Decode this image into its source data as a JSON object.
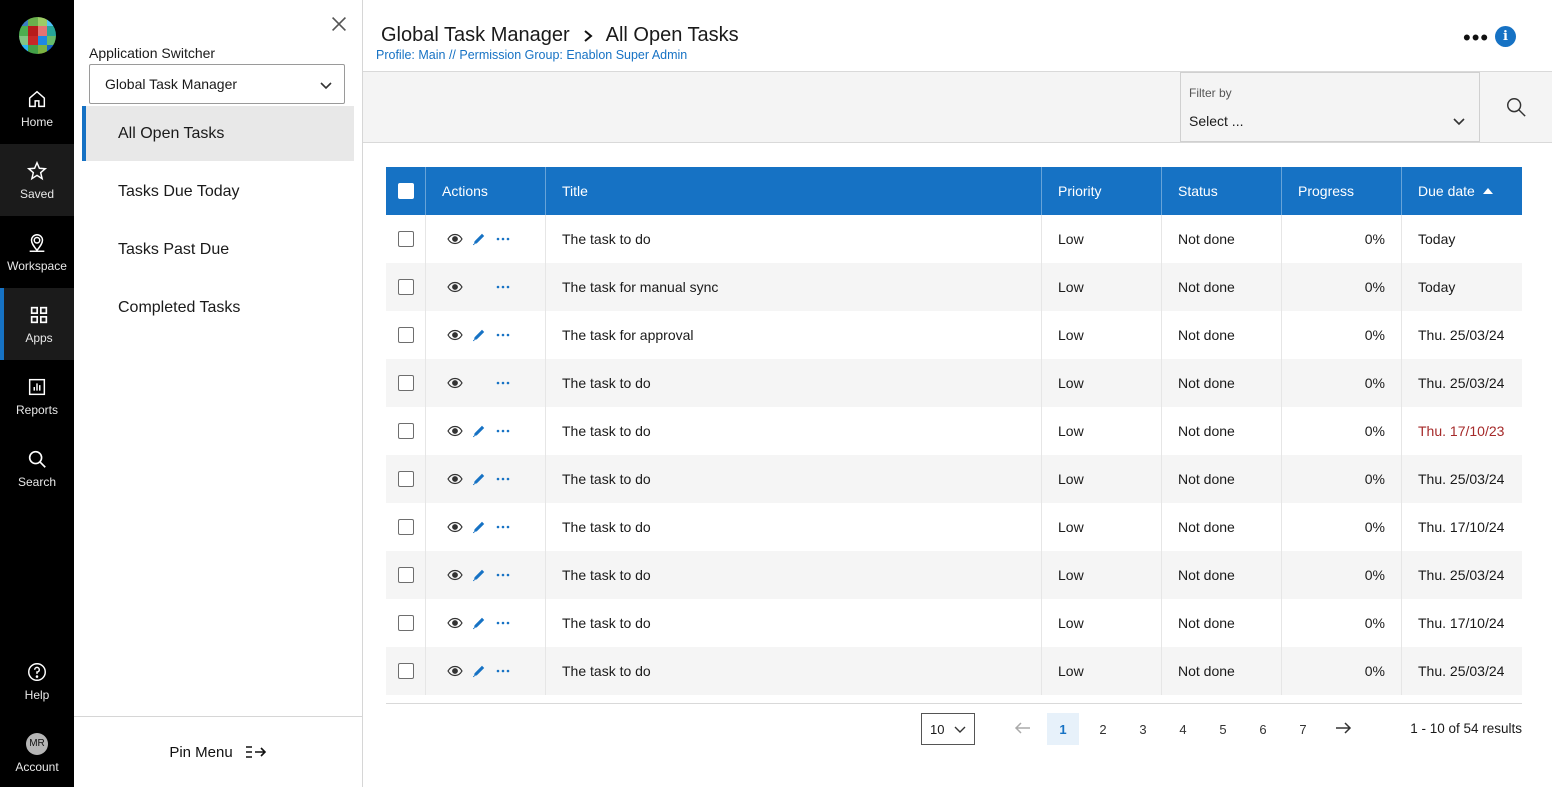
{
  "rail": {
    "items": [
      {
        "label": "Home",
        "icon": "home-icon"
      },
      {
        "label": "Saved",
        "icon": "star-icon"
      },
      {
        "label": "Workspace",
        "icon": "location-pin-icon"
      },
      {
        "label": "Apps",
        "icon": "apps-grid-icon"
      },
      {
        "label": "Reports",
        "icon": "bar-chart-icon"
      },
      {
        "label": "Search",
        "icon": "search-icon"
      },
      {
        "label": "Help",
        "icon": "help-icon"
      },
      {
        "label": "Account",
        "icon": "avatar"
      }
    ],
    "avatar_initials": "MR"
  },
  "switcher": {
    "label": "Application Switcher",
    "selected": "Global Task Manager",
    "nav": [
      "All Open Tasks",
      "Tasks Due Today",
      "Tasks Past Due",
      "Completed Tasks"
    ],
    "active_index": 0,
    "pin_label": "Pin Menu"
  },
  "header": {
    "app_title": "Global Task Manager",
    "page_title": "All Open Tasks",
    "profile": "Profile: Main // Permission Group: Enablon Super Admin",
    "more_label": "•••",
    "info_label": "i"
  },
  "filter": {
    "label": "Filter by",
    "value": "Select ..."
  },
  "table": {
    "columns": [
      "Actions",
      "Title",
      "Priority",
      "Status",
      "Progress",
      "Due date"
    ],
    "rows": [
      {
        "title": "The task to do",
        "priority": "Low",
        "status": "Not done",
        "progress": "0%",
        "due": "Today",
        "editable": true,
        "late": false
      },
      {
        "title": "The task for manual sync",
        "priority": "Low",
        "status": "Not done",
        "progress": "0%",
        "due": "Today",
        "editable": false,
        "late": false
      },
      {
        "title": "The task for approval",
        "priority": "Low",
        "status": "Not done",
        "progress": "0%",
        "due": "Thu. 25/03/24",
        "editable": true,
        "late": false
      },
      {
        "title": "The task to do",
        "priority": "Low",
        "status": "Not done",
        "progress": "0%",
        "due": "Thu. 25/03/24",
        "editable": false,
        "late": false
      },
      {
        "title": "The task to do",
        "priority": "Low",
        "status": "Not done",
        "progress": "0%",
        "due": "Thu. 17/10/23",
        "editable": true,
        "late": true
      },
      {
        "title": "The task to do",
        "priority": "Low",
        "status": "Not done",
        "progress": "0%",
        "due": "Thu. 25/03/24",
        "editable": true,
        "late": false
      },
      {
        "title": "The task to do",
        "priority": "Low",
        "status": "Not done",
        "progress": "0%",
        "due": "Thu. 17/10/24",
        "editable": true,
        "late": false
      },
      {
        "title": "The task to do",
        "priority": "Low",
        "status": "Not done",
        "progress": "0%",
        "due": "Thu. 25/03/24",
        "editable": true,
        "late": false
      },
      {
        "title": "The task to do",
        "priority": "Low",
        "status": "Not done",
        "progress": "0%",
        "due": "Thu. 17/10/24",
        "editable": true,
        "late": false
      },
      {
        "title": "The task to do",
        "priority": "Low",
        "status": "Not done",
        "progress": "0%",
        "due": "Thu. 25/03/24",
        "editable": true,
        "late": false
      }
    ]
  },
  "pagination": {
    "page_size": "10",
    "pages": [
      "1",
      "2",
      "3",
      "4",
      "5",
      "6",
      "7"
    ],
    "current": "1",
    "results": "1 - 10 of 54 results"
  },
  "colors": {
    "accent": "#1672c4",
    "late": "#a52a2a",
    "rail_bg": "#000000"
  }
}
